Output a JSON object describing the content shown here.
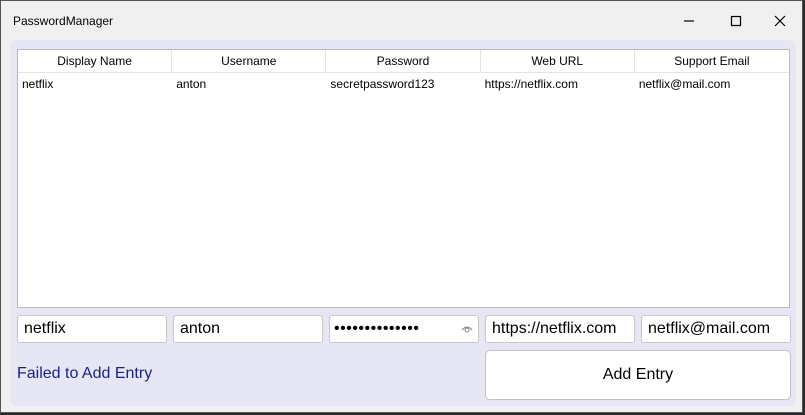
{
  "window": {
    "title": "PasswordManager",
    "controls": {
      "minimize": "minimize-icon",
      "maximize": "maximize-icon",
      "close": "close-icon"
    }
  },
  "table": {
    "columns": [
      "Display Name",
      "Username",
      "Password",
      "Web URL",
      "Support Email"
    ],
    "rows": [
      [
        "netflix",
        "anton",
        "secretpassword123",
        "https://netflix.com",
        "netflix@mail.com"
      ]
    ]
  },
  "form": {
    "display_name": "netflix",
    "username": "anton",
    "password_masked": "••••••••••••••",
    "password_reveal_icon": "eye-icon",
    "web_url": "https://netflix.com",
    "support_email": "netflix@mail.com"
  },
  "status_message": "Failed to Add Entry",
  "add_button_label": "Add Entry",
  "colors": {
    "client_bg": "#e6e6f5",
    "status_text": "#1a237e"
  }
}
